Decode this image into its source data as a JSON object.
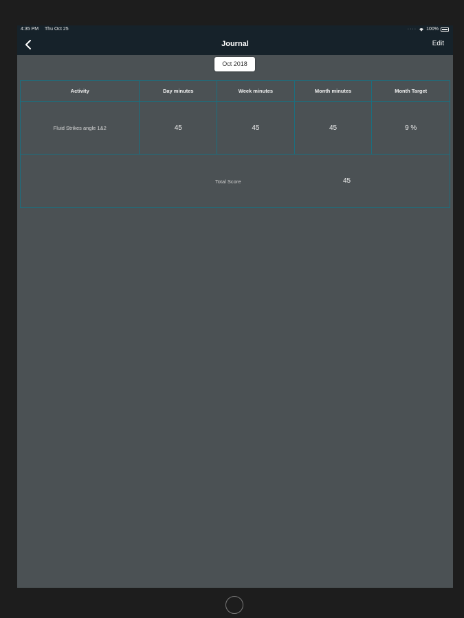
{
  "status_bar": {
    "time": "4:35 PM",
    "date": "Thu Oct 25",
    "battery": "100%"
  },
  "nav": {
    "title": "Journal",
    "edit_label": "Edit",
    "back_icon": "chevron-left-icon"
  },
  "month_selector": {
    "label": "Oct 2018"
  },
  "table": {
    "headers": [
      "Activity",
      "Day minutes",
      "Week minutes",
      "Month minutes",
      "Month Target"
    ],
    "rows": [
      {
        "activity": "Fluid Strikes angle 1&2",
        "day_minutes": "45",
        "week_minutes": "45",
        "month_minutes": "45",
        "month_target": "9 %"
      }
    ],
    "total_label": "Total Score",
    "total_value": "45"
  },
  "colors": {
    "background": "#4b5154",
    "nav_background": "#16222a",
    "table_border": "#1a6f80"
  }
}
